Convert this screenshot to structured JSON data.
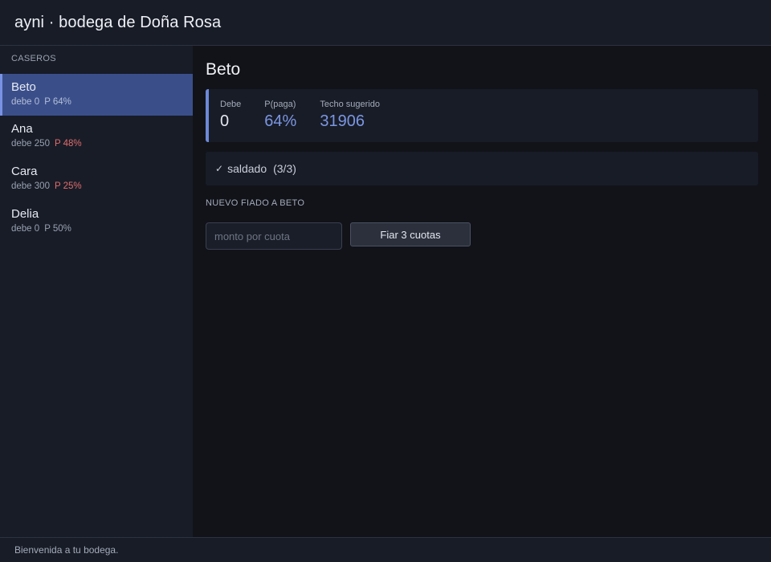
{
  "header": {
    "title": "ayni · bodega de Doña Rosa"
  },
  "sidebar": {
    "section_label": "CASEROS",
    "clients": [
      {
        "name": "Beto",
        "debt": "debe 0",
        "prob": "P 64%",
        "active": true,
        "risk": "neutral"
      },
      {
        "name": "Ana",
        "debt": "debe 250",
        "prob": "P 48%",
        "active": false,
        "risk": "bad"
      },
      {
        "name": "Cara",
        "debt": "debe 300",
        "prob": "P 25%",
        "active": false,
        "risk": "bad"
      },
      {
        "name": "Delia",
        "debt": "debe 0",
        "prob": "P 50%",
        "active": false,
        "risk": "neutral"
      }
    ]
  },
  "main": {
    "client_title": "Beto",
    "stats": [
      {
        "label": "Debe",
        "value": "0"
      },
      {
        "label": "P(paga)",
        "value": "64%"
      },
      {
        "label": "Techo sugerido",
        "value": "31906"
      }
    ],
    "status": {
      "check_icon": "check-icon",
      "text": "saldado",
      "count": "(3/3)"
    },
    "form": {
      "label": "NUEVO FIADO A BETO",
      "placeholder": "monto por cuota",
      "value": "",
      "button_label": "Fiar 3 cuotas"
    }
  },
  "statusbar": {
    "text": "Bienvenida a tu bodega."
  },
  "colors": {
    "accent": "#7b96e2",
    "active_row": "#3a4f8a",
    "danger": "#e06d6d",
    "panel": "#181c27",
    "background": "#111319"
  }
}
